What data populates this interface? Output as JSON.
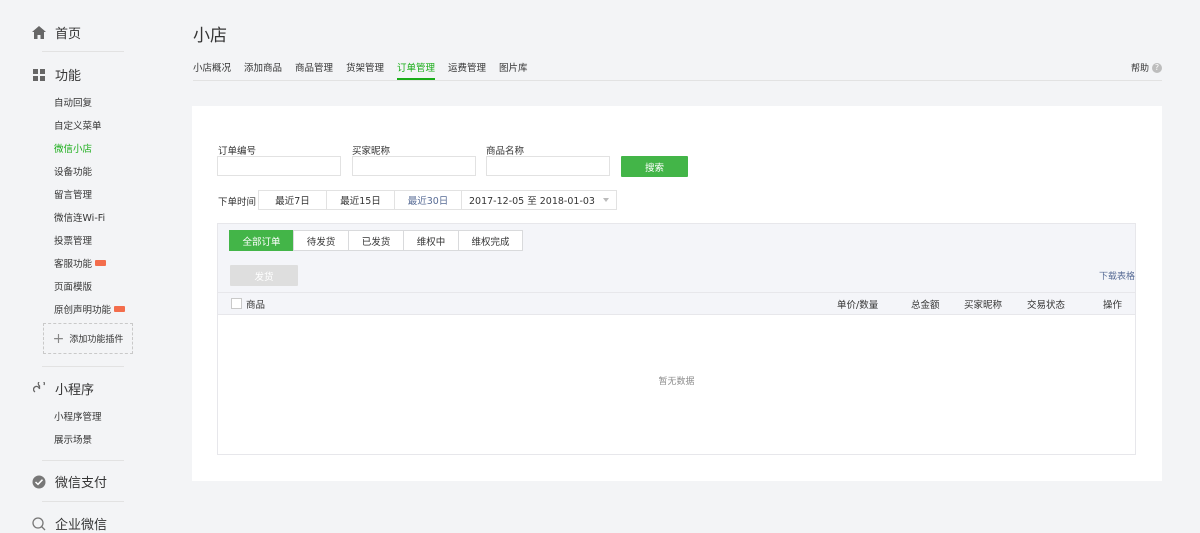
{
  "sidebar": {
    "home_label": "首页",
    "features_label": "功能",
    "features_items": [
      {
        "label": "自动回复"
      },
      {
        "label": "自定义菜单"
      },
      {
        "label": "微信小店"
      },
      {
        "label": "设备功能"
      },
      {
        "label": "留言管理"
      },
      {
        "label": "微信连Wi-Fi"
      },
      {
        "label": "投票管理"
      },
      {
        "label": "客服功能"
      },
      {
        "label": "页面模版"
      },
      {
        "label": "原创声明功能"
      }
    ],
    "add_plugin_label": "添加功能插件",
    "miniprogram_label": "小程序",
    "miniprogram_items": [
      {
        "label": "小程序管理"
      },
      {
        "label": "展示场景"
      }
    ],
    "pay_label": "微信支付",
    "work_label": "企业微信"
  },
  "page": {
    "title": "小店",
    "help_label": "帮助",
    "tabs": [
      {
        "label": "小店概况"
      },
      {
        "label": "添加商品"
      },
      {
        "label": "商品管理"
      },
      {
        "label": "货架管理"
      },
      {
        "label": "订单管理"
      },
      {
        "label": "运费管理"
      },
      {
        "label": "图片库"
      }
    ],
    "active_tab": "订单管理"
  },
  "filters": {
    "order_no_label": "订单编号",
    "order_no_value": "",
    "buyer_label": "买家昵称",
    "buyer_value": "",
    "product_label": "商品名称",
    "product_value": "",
    "search_label": "搜索",
    "date_label": "下单时间",
    "date_options": [
      {
        "label": "最近7日"
      },
      {
        "label": "最近15日"
      },
      {
        "label": "最近30日"
      }
    ],
    "selected_date_option": "最近30日",
    "date_range": "2017-12-05 至 2018-01-03"
  },
  "orders": {
    "status_tabs": [
      {
        "label": "全部订单"
      },
      {
        "label": "待发货"
      },
      {
        "label": "已发货"
      },
      {
        "label": "维权中"
      },
      {
        "label": "维权完成"
      }
    ],
    "active_status": "全部订单",
    "ship_label": "发货",
    "download_label": "下载表格",
    "columns": {
      "product": "商品",
      "price_qty": "单价/数量",
      "total": "总金额",
      "buyer": "买家昵称",
      "status": "交易状态",
      "action": "操作"
    },
    "empty_text": "暂无数据"
  },
  "colors": {
    "accent": "#1aad19",
    "button_green": "#43b548",
    "link_blue": "#576b95",
    "new_tag": "#f36d4c"
  }
}
